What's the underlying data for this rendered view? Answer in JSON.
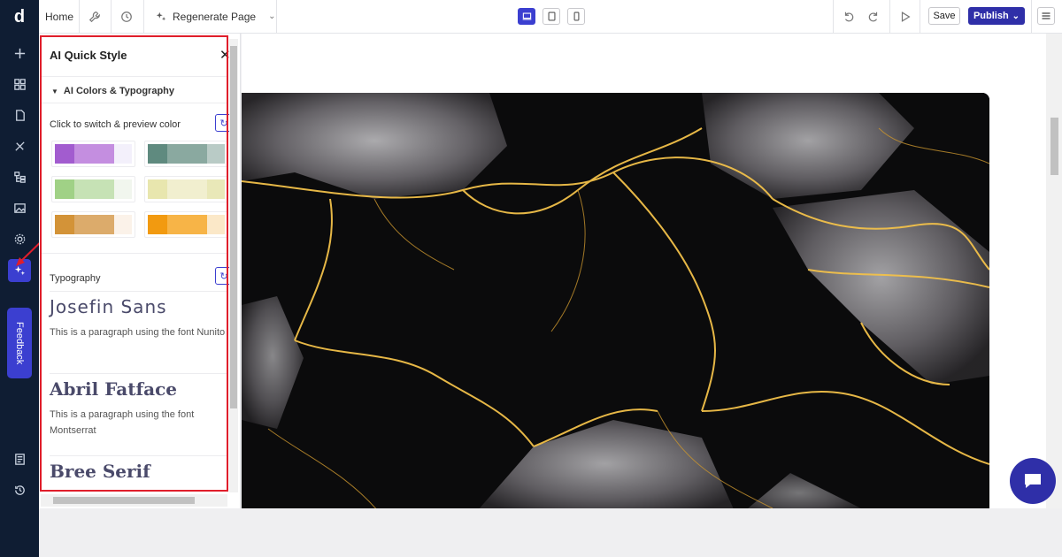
{
  "topbar": {
    "home_label": "Home",
    "regenerate_label": "Regenerate Page",
    "save_label": "Save",
    "publish_label": "Publish"
  },
  "sidebar": {
    "feedback_label": "Feedback"
  },
  "panel": {
    "title": "AI Quick Style",
    "section_label": "AI Colors & Typography",
    "color_hint": "Click to switch & preview color",
    "typography_label": "Typography",
    "palettes": [
      {
        "colors": [
          "#a25ccf",
          "#c48ee0",
          "#f3f0fb"
        ]
      },
      {
        "colors": [
          "#5f8a7f",
          "#8aa9a0",
          "#b9cbc6"
        ]
      },
      {
        "colors": [
          "#a0d186",
          "#c6e2b5",
          "#f1f6ee"
        ]
      },
      {
        "colors": [
          "#e8e6ae",
          "#f1efcf",
          "#e9e8b8"
        ]
      },
      {
        "colors": [
          "#d39338",
          "#dcab6b",
          "#fbf2e9"
        ]
      },
      {
        "colors": [
          "#f29a10",
          "#f7b447",
          "#fbe8c8"
        ]
      }
    ],
    "fonts": [
      {
        "name": "Josefin Sans",
        "desc": "This is a paragraph using the font Nunito"
      },
      {
        "name": "Abril Fatface",
        "desc": "This is a paragraph using the font Montserrat"
      },
      {
        "name": "Bree Serif",
        "desc": ""
      }
    ]
  },
  "colors": {
    "accent": "#3b3fd0",
    "rail": "#0f1d33",
    "highlight": "#e01e2b"
  }
}
